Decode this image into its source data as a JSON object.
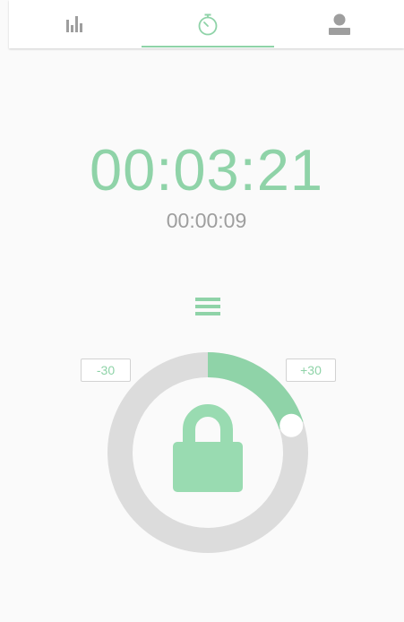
{
  "tabs": [
    {
      "name": "stats",
      "icon": "bar-chart-icon",
      "selected": false
    },
    {
      "name": "timer",
      "icon": "stopwatch-icon",
      "selected": true
    },
    {
      "name": "profile",
      "icon": "user-icon",
      "selected": false
    }
  ],
  "timer": {
    "main_time": "00:03:21",
    "sub_time": "00:00:09",
    "progress_fraction": 0.2
  },
  "controls": {
    "minus_label": "-30",
    "plus_label": "+30"
  },
  "colors": {
    "accent": "#8fd3a8",
    "ring_background": "#dcdcdc",
    "text_secondary": "#9e9e9e"
  },
  "icons": {
    "menu": "hamburger-menu-icon",
    "lock": "padlock-icon"
  }
}
